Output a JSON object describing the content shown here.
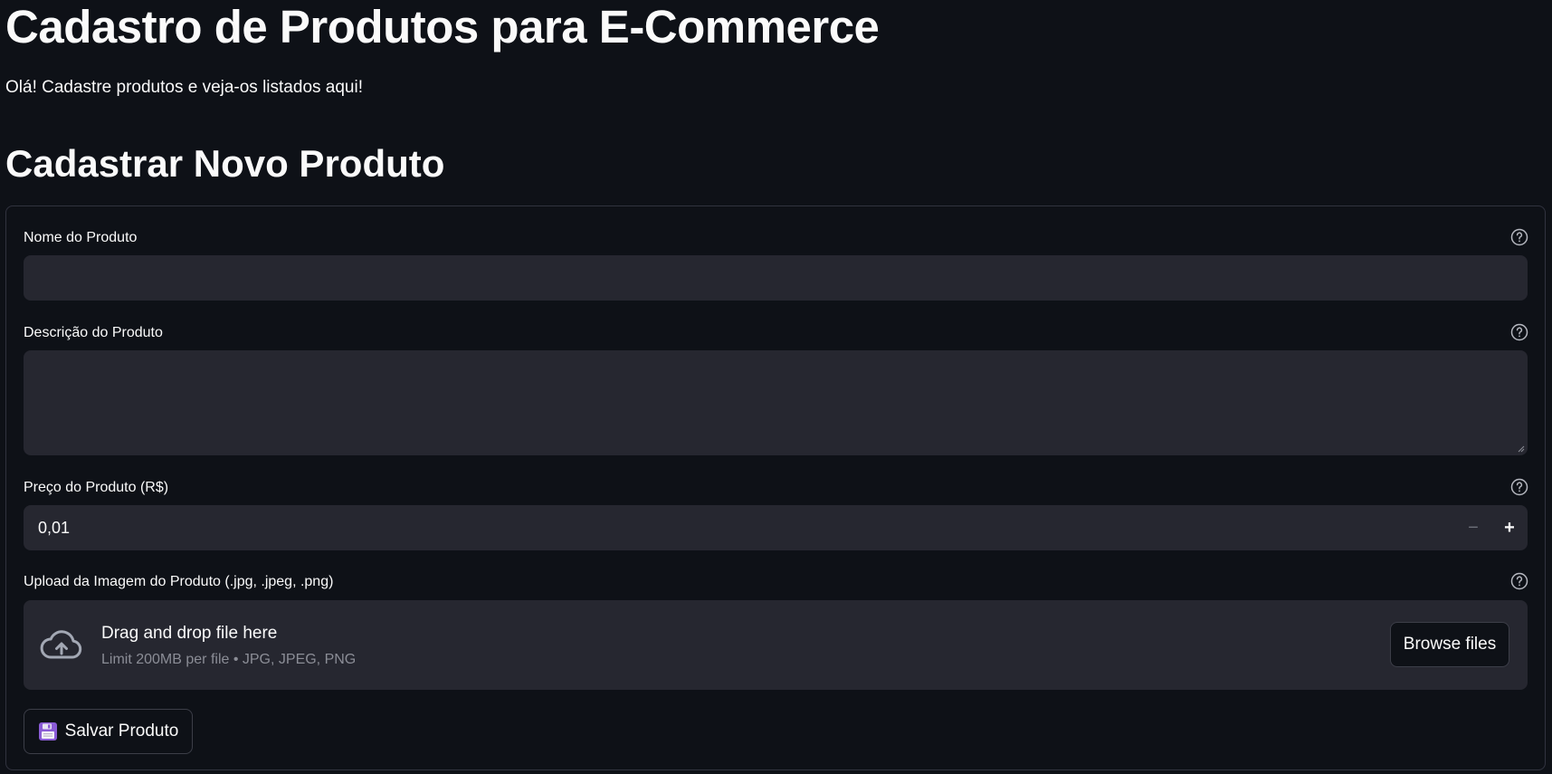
{
  "header": {
    "title": "Cadastro de Produtos para E-Commerce",
    "subtitle": "Olá! Cadastre produtos e veja-os listados aqui!"
  },
  "form": {
    "section_title": "Cadastrar Novo Produto",
    "name_field": {
      "label": "Nome do Produto",
      "value": "",
      "help_icon": "help-circle-icon"
    },
    "description_field": {
      "label": "Descrição do Produto",
      "value": "",
      "help_icon": "help-circle-icon"
    },
    "price_field": {
      "label": "Preço do Produto (R$)",
      "value": "0,01",
      "decrement": "−",
      "increment": "+",
      "help_icon": "help-circle-icon"
    },
    "upload_field": {
      "label": "Upload da Imagem do Produto (.jpg, .jpeg, .png)",
      "drop_text": "Drag and drop file here",
      "limit_text": "Limit 200MB per file • JPG, JPEG, PNG",
      "browse_label": "Browse files",
      "icon": "cloud-upload-icon",
      "help_icon": "help-circle-icon"
    },
    "save_button": {
      "label": "Salvar Produto",
      "icon": "floppy-disk-icon"
    }
  },
  "colors": {
    "background": "#0e1117",
    "input_bg": "#262730",
    "border": "#31333f",
    "text": "#fafafa",
    "muted_text": "#8b8d96"
  }
}
